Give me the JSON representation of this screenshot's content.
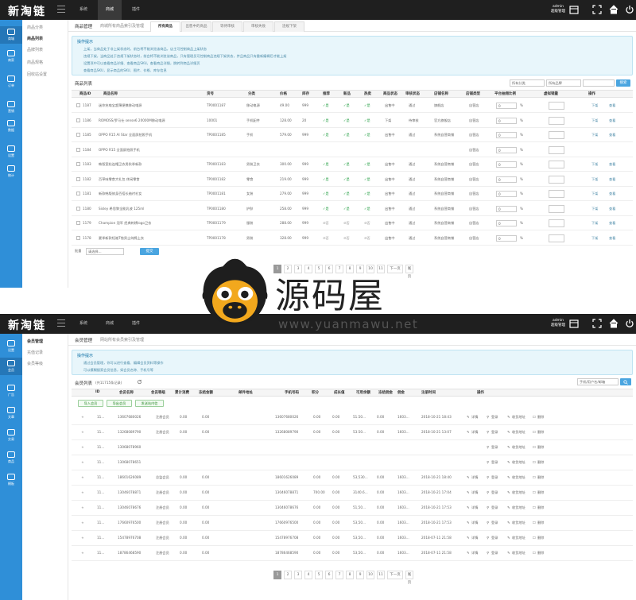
{
  "app": {
    "logo": "新淘链",
    "nav": [
      "系统",
      "商城",
      "插件"
    ],
    "nav_active": 1,
    "user": "admin",
    "user_role": "超级管理"
  },
  "panel1": {
    "sidebar": [
      "商城",
      "商家",
      "订单",
      "营销",
      "数据",
      "设置",
      "统计"
    ],
    "submenu": [
      "商品分类",
      "商品列表",
      "品牌列表",
      "商品规格",
      "回收站设置"
    ],
    "crumb_title": "商品管理",
    "crumb_sub": "商城所有商品索引及管理",
    "tabs": [
      "所有商品",
      "出售中的商品",
      "等待审核",
      "审核失败",
      "违规下架"
    ],
    "tips_title": "操作提示",
    "tips": [
      "上架，当商品处于非上架状态时，前台将不能浏览该商品，店主可控制商品上架状态",
      "违规下架，当商品处于违规下架状态时，前台将不能浏览该商品，只有管理员可控制商品违规下架状态，并且商品只有重新编辑后才能上架",
      "设置项中可以查看商品详细、查看商品SKU。查看商品详细，跳转到商品详细页",
      "查看商品SKU，显示商品的SKU、图片、价格、库存信息"
    ],
    "list_title": "商品列表",
    "filters": [
      "所有分类",
      "所有品牌"
    ],
    "search_label": "搜索",
    "columns": [
      "商品ID",
      "商品名称",
      "货号",
      "分类",
      "价格",
      "库存",
      "推荐",
      "新品",
      "热卖",
      "商品状态",
      "审核状态",
      "店铺名称",
      "店铺类型",
      "平台抽佣比例",
      "虚拟销量",
      "操作"
    ],
    "rows": [
      {
        "id": "1187",
        "name": "迷你充电宝超薄便携移动电源",
        "sn": "TP0001187",
        "cat": "移动电源",
        "price": "49.00",
        "stock": "999",
        "rec": "✓是",
        "new": "✓是",
        "hot": "✓是",
        "status": "出售中",
        "audit": "通过",
        "shop": "旗舰店",
        "shoptype": "自营店",
        "rate": "0",
        "virt": ""
      },
      {
        "id": "1186",
        "name": "ROMOSS/罗马仕 sense6 20000M移动电源",
        "sn": "10001",
        "cat": "手机配件",
        "price": "128.00",
        "stock": "20",
        "rec": "✓是",
        "new": "✓是",
        "hot": "✓是",
        "status": "下架",
        "audit": "待审核",
        "shop": "官方旗舰店",
        "shoptype": "自营店",
        "rate": "0",
        "virt": ""
      },
      {
        "id": "1185",
        "name": "OPPO R15 AI Star 全面屏拍照手机",
        "sn": "TP0001185",
        "cat": "手机",
        "price": "579.00",
        "stock": "999",
        "rec": "✓是",
        "new": "✓是",
        "hot": "✓是",
        "status": "出售中",
        "audit": "通过",
        "shop": "系统自营商铺",
        "shoptype": "自营店",
        "rate": "0",
        "virt": ""
      },
      {
        "id": "1184",
        "name": "OPPO R15 全面屏拍照手机",
        "sn": "",
        "cat": "",
        "price": "",
        "stock": "",
        "rec": "",
        "new": "",
        "hot": "",
        "status": "",
        "audit": "",
        "shop": "",
        "shoptype": "自营店",
        "rate": "0",
        "virt": ""
      },
      {
        "id": "1183",
        "name": "韩版宽松连帽卫衣男秋季新款",
        "sn": "TP0001183",
        "cat": "男装卫衣",
        "price": "300.00",
        "stock": "999",
        "rec": "✓是",
        "new": "✓是",
        "hot": "✓是",
        "status": "出售中",
        "audit": "通过",
        "shop": "系统自营商铺",
        "shoptype": "自营店",
        "rate": "0",
        "virt": ""
      },
      {
        "id": "1182",
        "name": "百草味零食大礼包 休闲零食",
        "sn": "TP0001182",
        "cat": "零食",
        "price": "219.00",
        "stock": "999",
        "rec": "✓是",
        "new": "✓是",
        "hot": "✓是",
        "status": "出售中",
        "audit": "通过",
        "shop": "系统自营商铺",
        "shoptype": "自营店",
        "rate": "0",
        "virt": ""
      },
      {
        "id": "1181",
        "name": "新款韩版修身百搭长袖衬衫女",
        "sn": "TP0001181",
        "cat": "女装",
        "price": "279.00",
        "stock": "999",
        "rec": "✓是",
        "new": "✓是",
        "hot": "✓是",
        "status": "出售中",
        "audit": "通过",
        "shop": "系统自营商铺",
        "shoptype": "自营店",
        "rate": "0",
        "virt": ""
      },
      {
        "id": "1180",
        "name": "Sisley 希思黎全能乳液 125ml",
        "sn": "TP0001180",
        "cat": "护肤",
        "price": "258.00",
        "stock": "999",
        "rec": "✓是",
        "new": "✓是",
        "hot": "✓是",
        "status": "出售中",
        "audit": "通过",
        "shop": "系统自营商铺",
        "shoptype": "自营店",
        "rate": "0",
        "virt": ""
      },
      {
        "id": "1179",
        "name": "Champion 冠军 经典刺绣logo卫衣",
        "sn": "TP0001179",
        "cat": "服装",
        "price": "288.00",
        "stock": "999",
        "rec": "⊘否",
        "new": "⊘否",
        "hot": "⊘否",
        "status": "出售中",
        "audit": "通过",
        "shop": "系统自营商铺",
        "shoptype": "自营店",
        "rate": "0",
        "virt": ""
      },
      {
        "id": "1178",
        "name": "夏季新款短袖T恤男士纯棉上衣",
        "sn": "TP0001178",
        "cat": "男装",
        "price": "328.00",
        "stock": "999",
        "rec": "⊘否",
        "new": "⊘否",
        "hot": "⊘否",
        "status": "出售中",
        "audit": "通过",
        "shop": "系统自营商铺",
        "shoptype": "自营店",
        "rate": "0",
        "virt": ""
      }
    ],
    "action_up": "下架",
    "action_view": "查看",
    "batch_label": "批量",
    "batch_select": "请选择...",
    "batch_btn": "提交",
    "pages": [
      "1",
      "2",
      "3",
      "4",
      "5",
      "6",
      "7",
      "8",
      "9",
      "10",
      "11",
      "下一页",
      "尾页"
    ]
  },
  "watermark": {
    "text": "源码屋",
    "url": "www.yuanmawu.net"
  },
  "panel2": {
    "sidebar": [
      "设置",
      "会员",
      "广告",
      "文章",
      "交易",
      "商品",
      "模板"
    ],
    "submenu": [
      "会员管理",
      "充值记录",
      "会员等级"
    ],
    "crumb_title": "会员管理",
    "crumb_sub": "网站所有会员索引及管理",
    "tips_title": "操作提示",
    "tips": [
      "通过会员管理，你可以进行查看、编辑会员资料等操作",
      "可以模糊搜索会员信息，如会员名称、手机号等"
    ],
    "list_title": "会员列表",
    "list_count": "(共11715条记录)",
    "search_placeholder": "手机/用户名/邮箱",
    "toolbar": [
      "导入会员",
      "导出会员",
      "发送站内信"
    ],
    "columns": [
      "ID",
      "会员名称",
      "会员等级",
      "累计消费",
      "冻结金额",
      "邮件地址",
      "手机号码",
      "积分",
      "成长值",
      "可用余额",
      "冻结佣金",
      "佣金",
      "注册时间",
      "操作"
    ],
    "rows": [
      {
        "id": "11...",
        "name": "13607680026",
        "lv": "注册会员",
        "total": "0.00",
        "frozen": "0.00",
        "email": "",
        "phone": "13607680026",
        "pts": "0.00",
        "grow": "0.00",
        "bal": "51.50...",
        "fc": "0.00",
        "com": "1603...",
        "time": "2018-10-21 18:43"
      },
      {
        "id": "11...",
        "name": "13268089790",
        "lv": "注册会员",
        "total": "0.00",
        "frozen": "0.00",
        "email": "",
        "phone": "13268089790",
        "pts": "0.00",
        "grow": "0.00",
        "bal": "53.50...",
        "fc": "0.00",
        "com": "1603...",
        "time": "2018-10-21 13:07"
      },
      {
        "id": "11...",
        "name": "13068078960",
        "lv": "",
        "total": "",
        "frozen": "",
        "email": "",
        "phone": "",
        "pts": "",
        "grow": "",
        "bal": "",
        "fc": "",
        "com": "",
        "time": ""
      },
      {
        "id": "11...",
        "name": "13068078651",
        "lv": "",
        "total": "",
        "frozen": "",
        "email": "",
        "phone": "",
        "pts": "",
        "grow": "",
        "bal": "",
        "fc": "",
        "com": "",
        "time": ""
      },
      {
        "id": "11...",
        "name": "18601626089",
        "lv": "总监会员",
        "total": "0.00",
        "frozen": "0.00",
        "email": "",
        "phone": "18601626089",
        "pts": "0.00",
        "grow": "0.00",
        "bal": "53,530...",
        "fc": "0.00",
        "com": "1603...",
        "time": "2018-10-21 18:40"
      },
      {
        "id": "11...",
        "name": "13046078871",
        "lv": "注册会员",
        "total": "0.00",
        "frozen": "0.00",
        "email": "",
        "phone": "13046078871",
        "pts": "700.00",
        "grow": "0.00",
        "bal": "3140.6...",
        "fc": "0.00",
        "com": "1603...",
        "time": "2018-10-21 17:04"
      },
      {
        "id": "11...",
        "name": "13046078676",
        "lv": "注册会员",
        "total": "0.00",
        "frozen": "0.00",
        "email": "",
        "phone": "13046078676",
        "pts": "0.00",
        "grow": "0.00",
        "bal": "51,50...",
        "fc": "0.00",
        "com": "1603...",
        "time": "2018-10-21 17:53"
      },
      {
        "id": "11...",
        "name": "17660976500",
        "lv": "注册会员",
        "total": "0.00",
        "frozen": "0.00",
        "email": "",
        "phone": "17660976500",
        "pts": "0.00",
        "grow": "0.00",
        "bal": "53,50...",
        "fc": "0.00",
        "com": "1603...",
        "time": "2018-10-21 17:53"
      },
      {
        "id": "11...",
        "name": "15478976708",
        "lv": "注册会员",
        "total": "0.00",
        "frozen": "0.00",
        "email": "",
        "phone": "15478976708",
        "pts": "0.00",
        "grow": "0.00",
        "bal": "53,50...",
        "fc": "0.00",
        "com": "1603...",
        "time": "2018-07-11 21:58"
      },
      {
        "id": "11...",
        "name": "18786468590",
        "lv": "注册会员",
        "total": "0.00",
        "frozen": "0.00",
        "email": "",
        "phone": "18786468590",
        "pts": "0.00",
        "grow": "0.00",
        "bal": "53,50...",
        "fc": "0.00",
        "com": "1603...",
        "time": "2018-07-11 21:58"
      }
    ],
    "actions": [
      "详情",
      "登录",
      "收货地址",
      "删除"
    ],
    "pages": [
      "1",
      "2",
      "3",
      "4",
      "5",
      "6",
      "7",
      "8",
      "9",
      "10",
      "11",
      "下一页",
      "尾页"
    ]
  },
  "colors": {
    "topbar": "#1f1f1f",
    "sidebar": "#2f8fd8",
    "accent": "#4aa5e0",
    "tips_bg": "#e8f6fb",
    "ok": "#2ea34c"
  }
}
